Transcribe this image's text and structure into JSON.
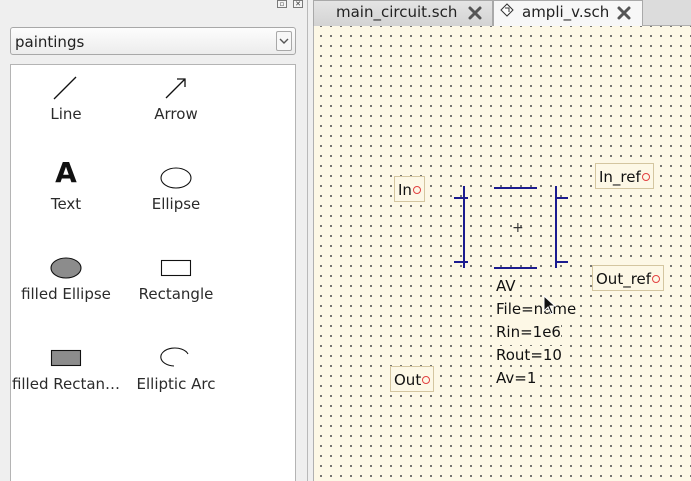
{
  "dock": {
    "combo": {
      "selected": "paintings"
    },
    "items": [
      {
        "label": "Line",
        "icon": "line-icon"
      },
      {
        "label": "Arrow",
        "icon": "arrow-icon"
      },
      {
        "label": "Text",
        "icon": "text-icon",
        "glyph": "A"
      },
      {
        "label": "Ellipse",
        "icon": "ellipse-icon"
      },
      {
        "label": "filled Ellipse",
        "icon": "filled-ellipse-icon"
      },
      {
        "label": "Rectangle",
        "icon": "rectangle-icon"
      },
      {
        "label": "filled Rectan…",
        "icon": "filled-rectangle-icon"
      },
      {
        "label": "Elliptic Arc",
        "icon": "elliptic-arc-icon"
      }
    ]
  },
  "tabs": [
    {
      "label": "main_circuit.sch",
      "active": false
    },
    {
      "label": "ampli_v.sch",
      "active": true
    }
  ],
  "schematic": {
    "ports": {
      "in": "In",
      "in_ref": "In_ref",
      "out_ref": "Out_ref",
      "out": "Out"
    },
    "component": {
      "center_mark": "+",
      "properties": [
        "AV",
        "File=name",
        "Rin=1e6",
        "Rout=10",
        "Av=1"
      ]
    },
    "colors": {
      "background": "#fdf8e6",
      "symbol": "#1b1b8f",
      "port_dot": "#e24040"
    }
  }
}
